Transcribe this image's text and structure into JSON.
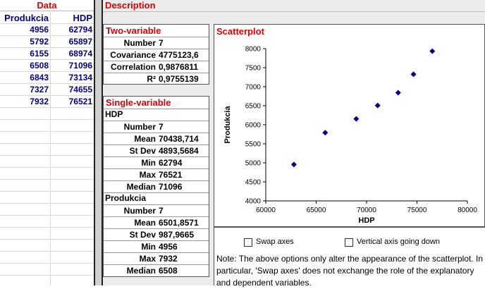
{
  "data_pane": {
    "title": "Data",
    "columns": [
      "Produkcia",
      "HDP"
    ],
    "rows": [
      [
        "4956",
        "62794"
      ],
      [
        "5792",
        "65897"
      ],
      [
        "6155",
        "68974"
      ],
      [
        "6508",
        "71096"
      ],
      [
        "6843",
        "73134"
      ],
      [
        "7327",
        "74655"
      ],
      [
        "7932",
        "76521"
      ]
    ]
  },
  "description": {
    "title": "Description",
    "two_variable": {
      "title": "Two-variable",
      "rows": [
        {
          "label": "Number",
          "value": "7"
        },
        {
          "label": "Covariance",
          "value": "4775123,6"
        },
        {
          "label": "Correlation",
          "value": "0,9876811"
        },
        {
          "label": "R²",
          "value": "0,9755139"
        }
      ]
    },
    "single_variable": {
      "title": "Single-variable",
      "groups": [
        {
          "name": "HDP",
          "rows": [
            {
              "label": "Number",
              "value": "7"
            },
            {
              "label": "Mean",
              "value": "70438,714"
            },
            {
              "label": "St Dev",
              "value": "4893,5684"
            },
            {
              "label": "Min",
              "value": "62794"
            },
            {
              "label": "Max",
              "value": "76521"
            },
            {
              "label": "Median",
              "value": "71096"
            }
          ]
        },
        {
          "name": "Produkcia",
          "rows": [
            {
              "label": "Number",
              "value": "7"
            },
            {
              "label": "Mean",
              "value": "6501,8571"
            },
            {
              "label": "St Dev",
              "value": "987,9665"
            },
            {
              "label": "Min",
              "value": "4956"
            },
            {
              "label": "Max",
              "value": "7932"
            },
            {
              "label": "Median",
              "value": "6508"
            }
          ]
        }
      ]
    }
  },
  "scatter": {
    "title": "Scatterplot",
    "options": {
      "swap_axes": "Swap axes",
      "vertical_down": "Vertical axis going down"
    },
    "note": "Note: The above options only alter the appearance of the scatterplot. In particular, 'Swap axes' does not exchange the role of the explanatory and dependent variables."
  },
  "chart_data": {
    "type": "scatter",
    "title": "",
    "xlabel": "HDP",
    "ylabel": "Produkcia",
    "xlim": [
      60000,
      80000
    ],
    "ylim": [
      4000,
      8000
    ],
    "xticks": [
      60000,
      65000,
      70000,
      75000,
      80000
    ],
    "yticks": [
      4000,
      4500,
      5000,
      5500,
      6000,
      6500,
      7000,
      7500,
      8000
    ],
    "x": [
      62794,
      65897,
      68974,
      71096,
      73134,
      74655,
      76521
    ],
    "y": [
      4956,
      5792,
      6155,
      6508,
      6843,
      7327,
      7932
    ],
    "marker_color": "#000080",
    "grid": false
  }
}
